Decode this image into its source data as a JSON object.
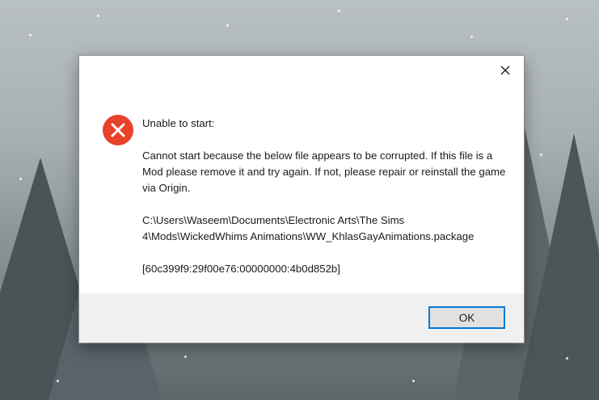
{
  "dialog": {
    "close_label": "✕",
    "heading": "Unable to start:",
    "body": "Cannot start because the below file appears to be corrupted. If this file is a Mod please remove it and try again.  If not, please repair or reinstall the game via Origin.",
    "path_line1": "C:\\Users\\Waseem\\Documents\\Electronic Arts\\The Sims",
    "path_line2": "4\\Mods\\WickedWhims Animations\\WW_KhlasGayAnimations.package",
    "error_code": "[60c399f9:29f00e76:00000000:4b0d852b]",
    "ok_label": "OK"
  },
  "icons": {
    "error": "error-x-circle-icon",
    "close": "close-icon"
  },
  "colors": {
    "error_red": "#e8422a",
    "accent_blue": "#0078d7",
    "footer_bg": "#f0f0f0"
  }
}
